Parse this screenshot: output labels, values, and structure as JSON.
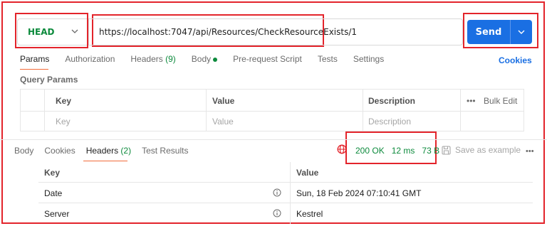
{
  "request": {
    "method": "HEAD",
    "url": "https://localhost:7047/api/Resources/CheckResourceExists/1",
    "send_label": "Send"
  },
  "request_tabs": [
    {
      "label": "Params"
    },
    {
      "label": "Authorization"
    },
    {
      "label": "Headers",
      "count": "(9)"
    },
    {
      "label": "Body"
    },
    {
      "label": "Pre-request Script"
    },
    {
      "label": "Tests"
    },
    {
      "label": "Settings"
    }
  ],
  "cookies_label": "Cookies",
  "query_params": {
    "title": "Query Params",
    "columns": [
      "Key",
      "Value",
      "Description"
    ],
    "bulk_edit": "Bulk Edit",
    "placeholders": [
      "Key",
      "Value",
      "Description"
    ]
  },
  "response_tabs": [
    {
      "label": "Body"
    },
    {
      "label": "Cookies"
    },
    {
      "label": "Headers",
      "count": "(2)"
    },
    {
      "label": "Test Results"
    }
  ],
  "response_status": {
    "status": "200 OK",
    "time": "12 ms",
    "size": "73 B"
  },
  "save_as_example": "Save as example",
  "response_headers": {
    "columns": [
      "Key",
      "Value"
    ],
    "rows": [
      {
        "key": "Date",
        "value": "Sun, 18 Feb 2024 07:10:41 GMT"
      },
      {
        "key": "Server",
        "value": "Kestrel"
      }
    ]
  },
  "colors": {
    "accent": "#1a6fe3",
    "success": "#0c8a3c",
    "tab_indicator": "#f26b3a",
    "highlight_box": "#e3242b"
  }
}
